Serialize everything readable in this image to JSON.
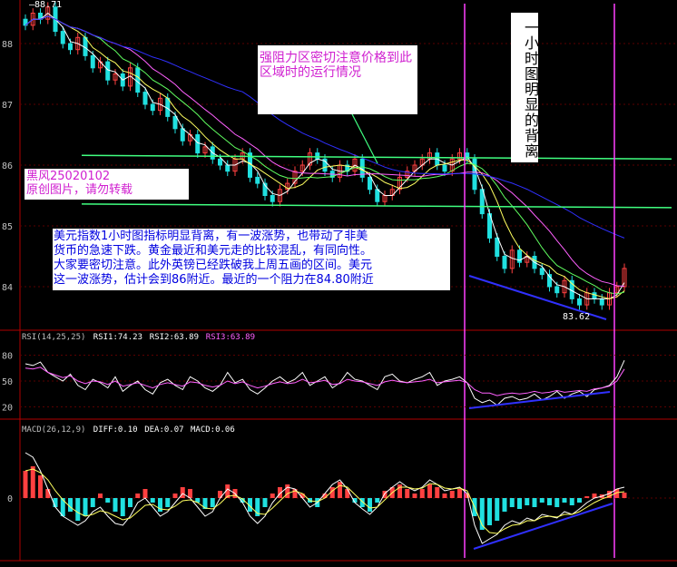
{
  "colors": {
    "background": "#000000",
    "axis": "#b00000",
    "grid": "#5a0000",
    "candle_up": "#ff4040",
    "candle_down": "#20e0e0",
    "ma_short": "#ffffff",
    "ma_mid": "#ffff60",
    "ma_long": "#60ff60",
    "ma_slow": "#ff60ff",
    "ma_blue": "#3030ff",
    "support_green": "#40ff80",
    "trend_blue": "#3030ff",
    "divergence_magenta": "#ff40ff",
    "macd_pos": "#ff4040",
    "macd_neg": "#20e0e0"
  },
  "annotations": {
    "resistance_note": "强阻力区密切注意价格到此区域时的运行情况",
    "hour_divergence_note": "一小时图明显的背离",
    "author_tag_line1": "黑风25020102",
    "author_tag_line2": "原创图片，请勿转载",
    "analysis_lines": [
      "美元指数1小时图指标明显背离，有一波涨势，也带动了非美",
      "货币的急速下跌。黄金最近和美元走的比较混乱，有同向性。",
      "大家要密切注意。此外英镑已经跌破我上周五画的区间。美元",
      "这一波涨势，估计会到86附近。最近的一个阻力在84.80附近"
    ]
  },
  "chart_data": [
    {
      "id": "price",
      "type": "candlestick",
      "yticks": [
        "88",
        "87",
        "86",
        "85",
        "84"
      ],
      "ylim": [
        83.45,
        88.9
      ],
      "high_label": "88.71",
      "low_label": "83.62",
      "support_levels": [
        86.1,
        85.3
      ],
      "series_close": [
        88.3,
        88.5,
        88.4,
        88.6,
        88.2,
        88.0,
        87.9,
        88.1,
        87.8,
        87.6,
        87.7,
        87.4,
        87.5,
        87.3,
        87.6,
        87.2,
        87.0,
        86.9,
        87.1,
        86.8,
        86.6,
        86.4,
        86.5,
        86.2,
        86.3,
        86.1,
        86.0,
        85.9,
        86.1,
        86.2,
        85.8,
        85.7,
        85.5,
        85.4,
        85.6,
        85.7,
        85.9,
        86.0,
        86.2,
        86.1,
        85.9,
        85.8,
        86.0,
        85.9,
        86.1,
        85.8,
        85.6,
        85.4,
        85.5,
        85.6,
        85.8,
        85.9,
        86.0,
        86.1,
        86.2,
        86.0,
        85.9,
        86.1,
        86.2,
        86.1,
        85.6,
        85.2,
        84.8,
        84.5,
        84.3,
        84.6,
        84.4,
        84.5,
        84.3,
        84.2,
        84.0,
        83.9,
        84.1,
        83.8,
        83.7,
        83.9,
        83.8,
        83.7,
        83.9,
        84.0,
        84.3
      ]
    },
    {
      "id": "rsi",
      "type": "line",
      "title": "RSI(14,25,25)",
      "legend": [
        {
          "name": "RSI1",
          "value": "74.23"
        },
        {
          "name": "RSI2",
          "value": "63.89"
        },
        {
          "name": "RSI3",
          "value": "63.89"
        }
      ],
      "yticks": [
        "80",
        "50",
        "20"
      ],
      "ylim": [
        10,
        90
      ],
      "series": [
        {
          "name": "RSI1",
          "values": [
            70,
            68,
            72,
            60,
            55,
            50,
            58,
            45,
            40,
            52,
            48,
            42,
            55,
            38,
            45,
            50,
            40,
            35,
            48,
            52,
            45,
            40,
            55,
            50,
            42,
            38,
            45,
            60,
            48,
            52,
            40,
            35,
            42,
            50,
            55,
            48,
            52,
            60,
            45,
            50,
            55,
            42,
            48,
            60,
            52,
            50,
            45,
            40,
            55,
            58,
            50,
            48,
            52,
            55,
            60,
            45,
            50,
            52,
            55,
            48,
            30,
            25,
            28,
            22,
            30,
            32,
            28,
            30,
            35,
            28,
            32,
            38,
            30,
            35,
            38,
            32,
            40,
            42,
            45,
            55,
            74
          ]
        },
        {
          "name": "RSI2",
          "values": [
            65,
            64,
            66,
            60,
            57,
            54,
            56,
            50,
            47,
            50,
            49,
            46,
            50,
            44,
            46,
            48,
            45,
            42,
            46,
            48,
            46,
            44,
            49,
            48,
            45,
            43,
            45,
            50,
            47,
            49,
            45,
            42,
            44,
            47,
            49,
            47,
            48,
            52,
            48,
            49,
            51,
            46,
            47,
            52,
            50,
            49,
            47,
            45,
            49,
            51,
            49,
            48,
            49,
            50,
            52,
            48,
            49,
            50,
            51,
            48,
            40,
            36,
            36,
            33,
            35,
            36,
            35,
            36,
            38,
            36,
            37,
            39,
            37,
            38,
            39,
            38,
            41,
            42,
            44,
            50,
            63.89
          ]
        }
      ]
    },
    {
      "id": "macd",
      "type": "bar",
      "title": "MACD(26,12,9)",
      "legend": [
        {
          "name": "DIFF",
          "value": "0.10"
        },
        {
          "name": "DEA",
          "value": "0.07"
        },
        {
          "name": "MACD",
          "value": "0.06"
        }
      ],
      "yticks": [
        "0"
      ],
      "ylim": [
        -0.6,
        0.6
      ],
      "histogram": [
        0.3,
        0.35,
        0.25,
        0.1,
        -0.1,
        -0.2,
        -0.15,
        -0.25,
        -0.2,
        -0.1,
        0.05,
        -0.05,
        -0.15,
        -0.2,
        -0.1,
        0.05,
        0.1,
        -0.05,
        -0.15,
        -0.1,
        0.05,
        0.12,
        0.1,
        -0.05,
        -0.12,
        -0.1,
        0.08,
        0.15,
        0.1,
        -0.05,
        -0.15,
        -0.2,
        -0.1,
        0.05,
        0.12,
        0.15,
        0.1,
        0.05,
        -0.05,
        -0.1,
        0.05,
        0.12,
        0.18,
        0.1,
        -0.05,
        -0.1,
        -0.15,
        -0.05,
        0.08,
        0.12,
        0.15,
        0.1,
        0.05,
        0.1,
        0.15,
        0.12,
        0.05,
        0.08,
        0.1,
        0.05,
        -0.2,
        -0.35,
        -0.3,
        -0.25,
        -0.15,
        -0.1,
        -0.12,
        -0.08,
        -0.1,
        -0.05,
        -0.08,
        -0.1,
        -0.05,
        -0.08,
        -0.05,
        0.02,
        0.05,
        0.04,
        0.08,
        0.1,
        0.06
      ],
      "series": [
        {
          "name": "DIFF",
          "values": [
            0.5,
            0.45,
            0.3,
            0.1,
            -0.1,
            -0.2,
            -0.25,
            -0.3,
            -0.25,
            -0.15,
            -0.1,
            -0.2,
            -0.28,
            -0.3,
            -0.2,
            -0.05,
            0.0,
            -0.1,
            -0.2,
            -0.15,
            -0.05,
            0.05,
            0.0,
            -0.1,
            -0.2,
            -0.15,
            0.0,
            0.1,
            0.05,
            -0.05,
            -0.2,
            -0.28,
            -0.2,
            -0.05,
            0.05,
            0.12,
            0.1,
            0.0,
            -0.1,
            -0.05,
            0.05,
            0.15,
            0.2,
            0.1,
            -0.05,
            -0.12,
            -0.18,
            -0.1,
            0.05,
            0.12,
            0.18,
            0.12,
            0.08,
            0.12,
            0.2,
            0.15,
            0.08,
            0.1,
            0.12,
            0.05,
            -0.3,
            -0.5,
            -0.45,
            -0.4,
            -0.3,
            -0.25,
            -0.28,
            -0.22,
            -0.25,
            -0.18,
            -0.2,
            -0.22,
            -0.15,
            -0.18,
            -0.12,
            -0.05,
            0.0,
            0.02,
            0.05,
            0.1,
            0.12
          ]
        },
        {
          "name": "DEA",
          "values": [
            0.3,
            0.32,
            0.28,
            0.2,
            0.08,
            -0.02,
            -0.1,
            -0.16,
            -0.2,
            -0.18,
            -0.14,
            -0.16,
            -0.2,
            -0.24,
            -0.22,
            -0.15,
            -0.08,
            -0.07,
            -0.12,
            -0.13,
            -0.09,
            -0.03,
            -0.02,
            -0.05,
            -0.11,
            -0.12,
            -0.06,
            0.02,
            0.03,
            -0.01,
            -0.09,
            -0.17,
            -0.18,
            -0.11,
            -0.03,
            0.05,
            0.08,
            0.05,
            -0.03,
            -0.04,
            0.0,
            0.08,
            0.14,
            0.12,
            0.04,
            -0.04,
            -0.11,
            -0.1,
            -0.02,
            0.06,
            0.12,
            0.12,
            0.1,
            0.11,
            0.16,
            0.15,
            0.11,
            0.1,
            0.11,
            0.08,
            -0.1,
            -0.3,
            -0.38,
            -0.39,
            -0.34,
            -0.3,
            -0.29,
            -0.25,
            -0.25,
            -0.21,
            -0.2,
            -0.21,
            -0.18,
            -0.18,
            -0.15,
            -0.1,
            -0.05,
            -0.01,
            0.02,
            0.06,
            0.07
          ]
        }
      ]
    }
  ]
}
